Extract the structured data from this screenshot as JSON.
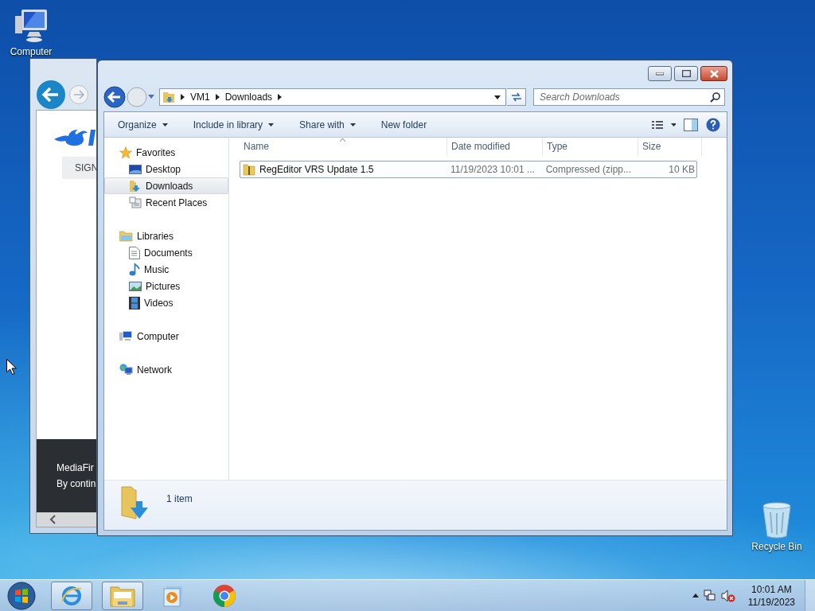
{
  "desktop_icons": [
    {
      "label": "Computer",
      "kind": "computer"
    },
    {
      "label": "Recycle Bin",
      "kind": "recycle"
    }
  ],
  "browser": {
    "button": "SIGN",
    "notice_lines": [
      "MediaFir",
      "By contin"
    ]
  },
  "explorer": {
    "path": [
      "VM1",
      "Downloads"
    ],
    "search": {
      "placeholder": "Search Downloads"
    },
    "toolbar": [
      {
        "label": "Organize",
        "dropdown": true
      },
      {
        "label": "Include in library",
        "dropdown": true
      },
      {
        "label": "Share with",
        "dropdown": true
      },
      {
        "label": "New folder",
        "dropdown": false
      }
    ],
    "nav": [
      {
        "label": "Favorites",
        "kind": "star",
        "selected": false,
        "children": [
          {
            "label": "Desktop",
            "kind": "desktop",
            "selected": false
          },
          {
            "label": "Downloads",
            "kind": "downloads",
            "selected": true
          },
          {
            "label": "Recent Places",
            "kind": "recent",
            "selected": false
          }
        ]
      },
      {
        "label": "Libraries",
        "kind": "libraries",
        "selected": false,
        "children": [
          {
            "label": "Documents",
            "kind": "documents",
            "selected": false
          },
          {
            "label": "Music",
            "kind": "music",
            "selected": false
          },
          {
            "label": "Pictures",
            "kind": "pictures",
            "selected": false
          },
          {
            "label": "Videos",
            "kind": "videos",
            "selected": false
          }
        ]
      },
      {
        "label": "Computer",
        "kind": "computer",
        "selected": false
      },
      {
        "label": "Network",
        "kind": "network",
        "selected": false
      }
    ],
    "columns": [
      "Name",
      "Date modified",
      "Type",
      "Size"
    ],
    "files": [
      {
        "name": "RegEditor VRS Update 1.5",
        "date_modified": "11/19/2023 10:01 ...",
        "type": "Compressed (zipp...",
        "size": "10 KB",
        "selected": true
      }
    ],
    "status": "1 item"
  },
  "taskbar": {
    "apps": [
      {
        "kind": "ie",
        "running": true
      },
      {
        "kind": "explorer",
        "running": true
      },
      {
        "kind": "media",
        "running": false
      },
      {
        "kind": "chrome",
        "running": false
      }
    ],
    "time": "10:01 AM",
    "date": "11/19/2023"
  }
}
